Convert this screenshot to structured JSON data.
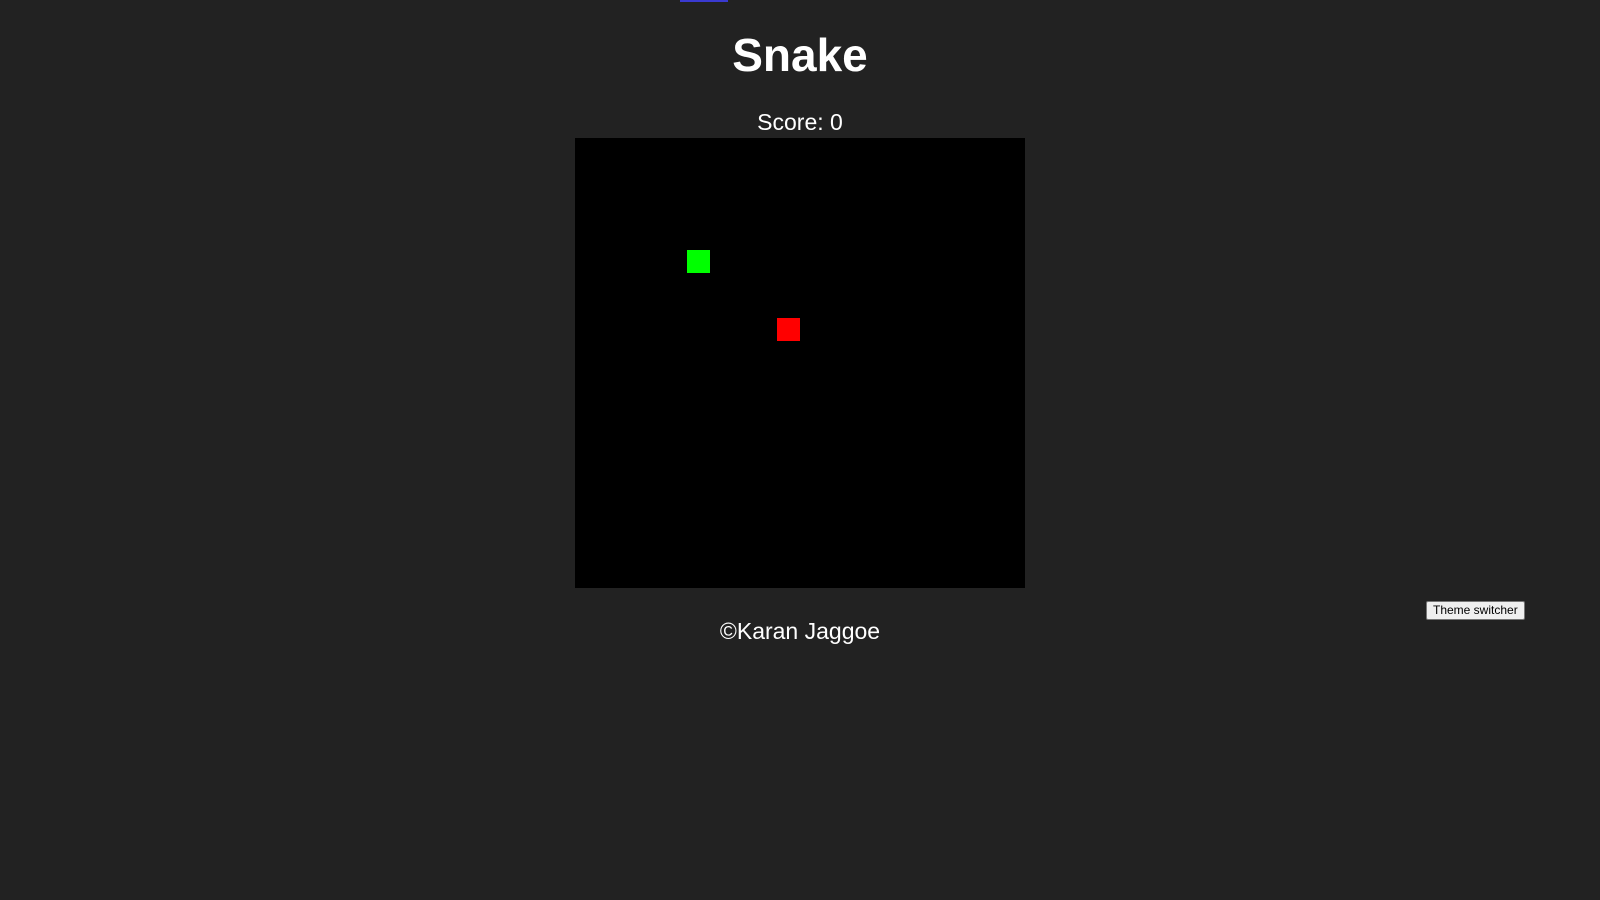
{
  "title": "Snake",
  "score_text": "Score: 0",
  "board": {
    "background_color": "#000000",
    "snake_color": "#00ff00",
    "food_color": "#ff0000"
  },
  "theme_button_label": "Theme switcher",
  "footer_text": "©Karan Jaggoe",
  "colors": {
    "page_background": "#222222",
    "text": "#ffffff"
  }
}
